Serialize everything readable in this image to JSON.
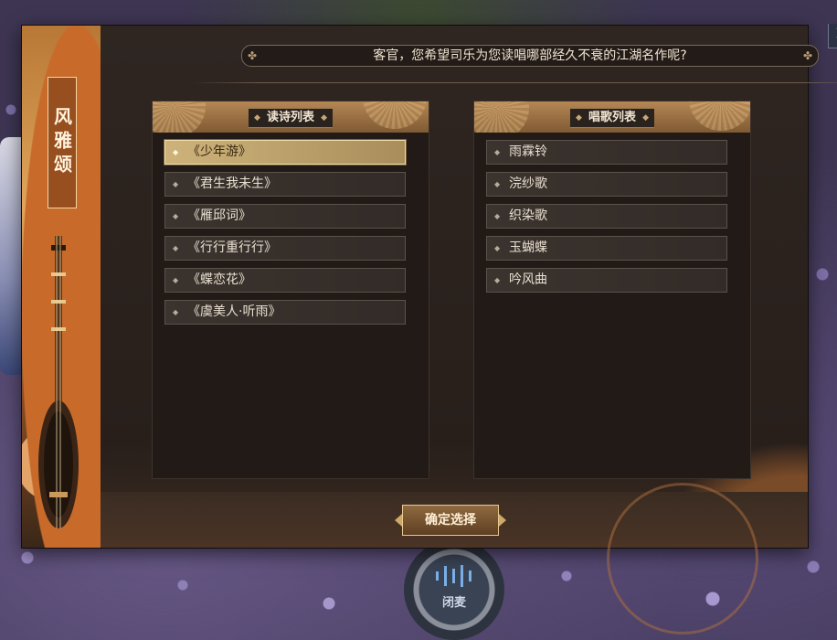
{
  "dialog": {
    "title": "风雅颂",
    "question": "客官，您希望司乐为您读唱哪部经久不衰的江湖名作呢?",
    "close_label": "✕",
    "confirm_label": "确定选择"
  },
  "poem_panel": {
    "header": "读诗列表",
    "items": [
      "《少年游》",
      "《君生我未生》",
      "《雁邱词》",
      "《行行重行行》",
      "《蝶恋花》",
      "《虞美人·听雨》"
    ],
    "selected_index": 0
  },
  "song_panel": {
    "header": "唱歌列表",
    "items": [
      "雨霖铃",
      "浣纱歌",
      "织染歌",
      "玉蝴蝶",
      "吟风曲"
    ]
  },
  "background": {
    "mic_label": "闭麦"
  },
  "colors": {
    "selected_item": "#cdb37a",
    "panel_header": "#b58754",
    "dialog_bg": "#2c2420"
  }
}
